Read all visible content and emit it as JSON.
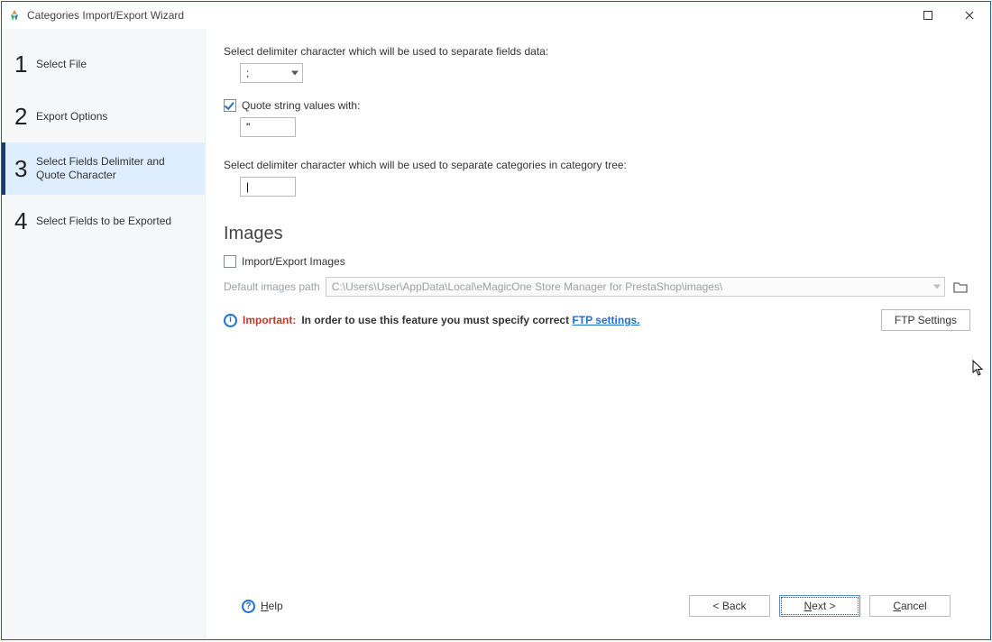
{
  "window": {
    "title": "Categories Import/Export Wizard"
  },
  "sidebar": {
    "steps": [
      {
        "num": "1",
        "label": "Select File"
      },
      {
        "num": "2",
        "label": "Export Options"
      },
      {
        "num": "3",
        "label": "Select Fields Delimiter and Quote Character"
      },
      {
        "num": "4",
        "label": "Select Fields to be Exported"
      }
    ],
    "active_index": 2
  },
  "delimiter": {
    "label": "Select delimiter character which will be used to separate fields data:",
    "value": ";"
  },
  "quote": {
    "checkbox_label": "Quote string values with:",
    "checked": true,
    "value": "\""
  },
  "tree_delimiter": {
    "label": "Select delimiter character which will be used to separate categories in category tree:",
    "value": "|"
  },
  "images": {
    "heading": "Images",
    "checkbox_label": "Import/Export Images",
    "checked": false,
    "path_label": "Default images path",
    "path_value": "C:\\Users\\User\\AppData\\Local\\eMagicOne Store Manager for PrestaShop\\images\\",
    "important_label": "Important:",
    "important_text": "In order to use this feature you must specify correct ",
    "ftp_link": "FTP settings.",
    "ftp_button": "FTP Settings"
  },
  "footer": {
    "help": "Help",
    "back": "< Back",
    "next": "Next >",
    "cancel": "Cancel"
  }
}
